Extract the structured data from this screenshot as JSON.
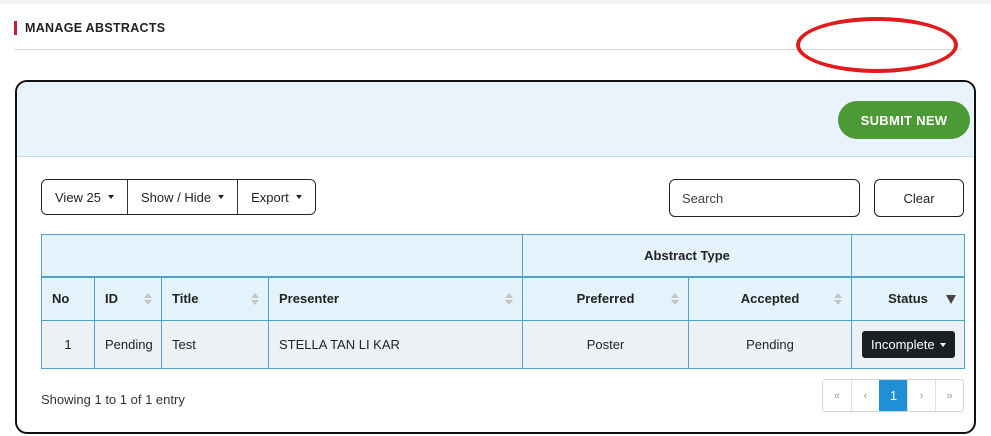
{
  "section": {
    "title": "MANAGE ABSTRACTS"
  },
  "header": {
    "submit_label": "SUBMIT NEW"
  },
  "toolbar": {
    "view_label": "View 25",
    "showhide_label": "Show / Hide",
    "export_label": "Export",
    "search_placeholder": "Search",
    "search_value": "",
    "clear_label": "Clear"
  },
  "table": {
    "group_header": "Abstract Type",
    "columns": [
      "No",
      "ID",
      "Title",
      "Presenter",
      "Preferred",
      "Accepted",
      "Status"
    ],
    "rows": [
      {
        "no": "1",
        "id": "Pending",
        "title": "Test",
        "presenter": "STELLA TAN LI KAR",
        "preferred": "Poster",
        "accepted": "Pending",
        "status": "Incomplete"
      }
    ]
  },
  "footer": {
    "info": "Showing 1 to 1 of 1 entry",
    "pagination": {
      "first": "«",
      "prev": "‹",
      "current": "1",
      "next": "›",
      "last": "»"
    }
  },
  "colors": {
    "accent_red": "#c0223a",
    "submit_green": "#4c9a35",
    "table_border": "#4fa3c9",
    "header_bg": "#e3f2fb",
    "page_active": "#1f8fd6",
    "highlight": "#e01b1b"
  }
}
